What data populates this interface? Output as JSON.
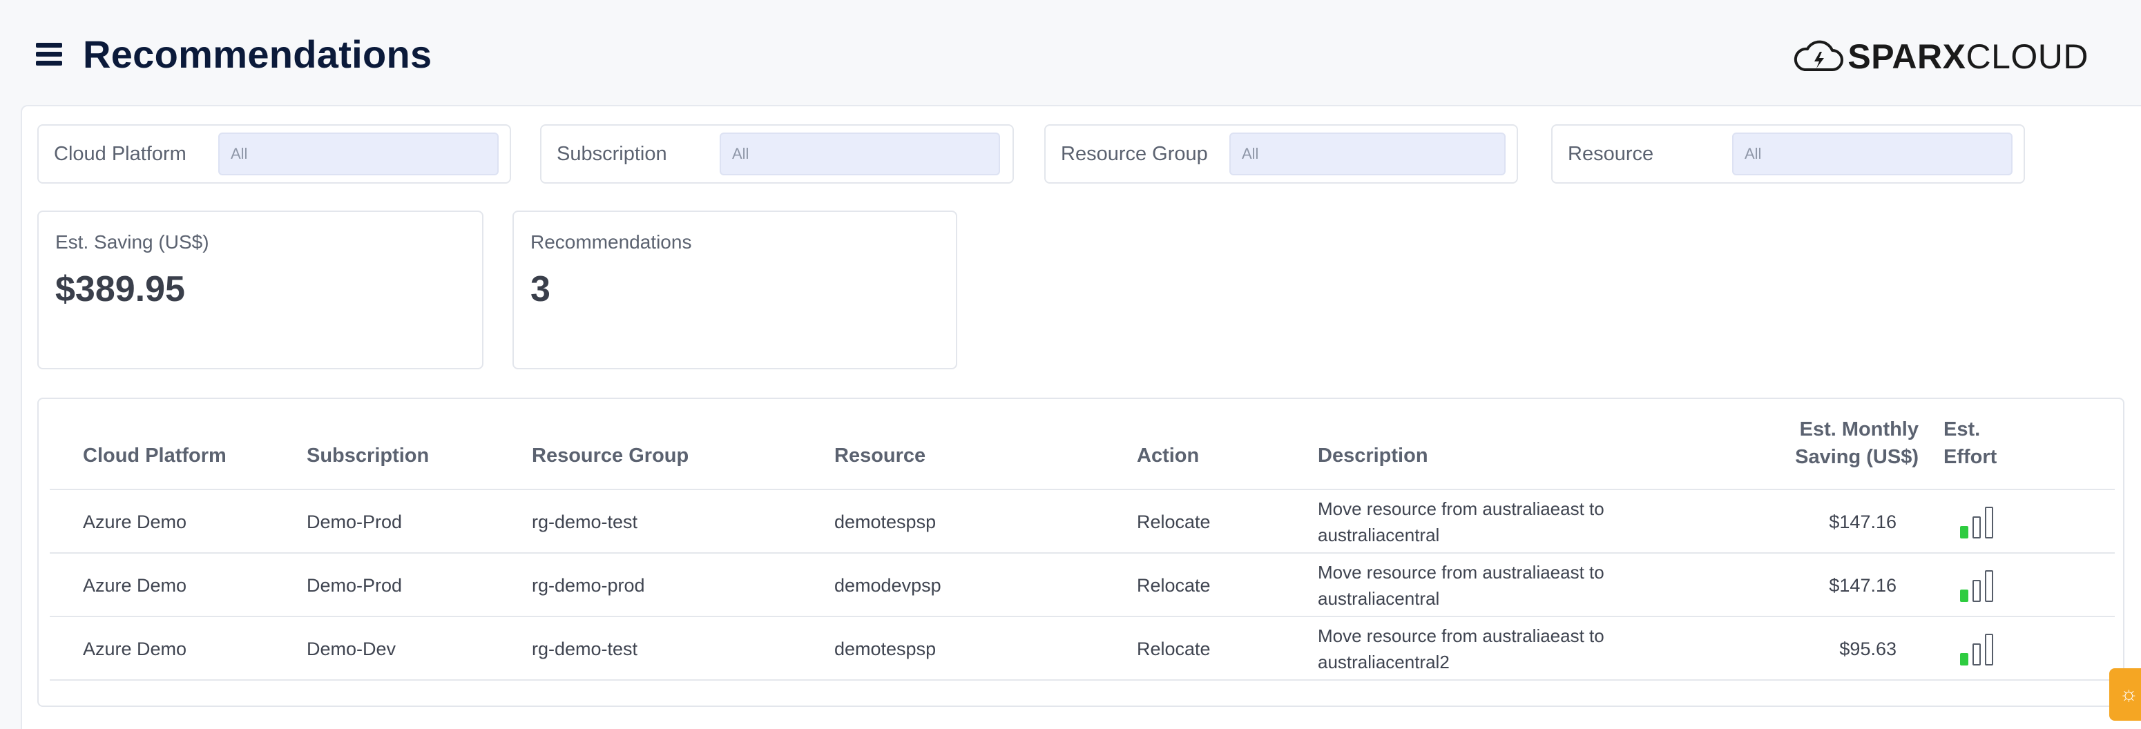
{
  "header": {
    "title": "Recommendations",
    "logo_bold": "SPARX",
    "logo_regular": "CLOUD"
  },
  "filters": [
    {
      "label": "Cloud Platform",
      "value": "All"
    },
    {
      "label": "Subscription",
      "value": "All"
    },
    {
      "label": "Resource Group",
      "value": "All"
    },
    {
      "label": "Resource",
      "value": "All"
    }
  ],
  "summary": {
    "saving_label": "Est. Saving (US$)",
    "saving_value": "$389.95",
    "recs_label": "Recommendations",
    "recs_value": "3"
  },
  "table": {
    "columns": {
      "platform": "Cloud Platform",
      "subscription": "Subscription",
      "resource_group": "Resource Group",
      "resource": "Resource",
      "action": "Action",
      "description": "Description",
      "saving_line1": "Est. Monthly",
      "saving_line2": "Saving (US$)",
      "effort_line1": "Est.",
      "effort_line2": "Effort"
    },
    "rows": [
      {
        "platform": "Azure Demo",
        "subscription": "Demo-Prod",
        "resource_group": "rg-demo-test",
        "resource": "demotespsp",
        "action": "Relocate",
        "desc_line1": "Move resource from australiaeast to",
        "desc_line2": "australiacentral",
        "saving": "$147.16",
        "effort_level": 1
      },
      {
        "platform": "Azure Demo",
        "subscription": "Demo-Prod",
        "resource_group": "rg-demo-prod",
        "resource": "demodevpsp",
        "action": "Relocate",
        "desc_line1": "Move resource from australiaeast to",
        "desc_line2": "australiacentral",
        "saving": "$147.16",
        "effort_level": 1
      },
      {
        "platform": "Azure Demo",
        "subscription": "Demo-Dev",
        "resource_group": "rg-demo-test",
        "resource": "demotespsp",
        "action": "Relocate",
        "desc_line1": "Move resource from australiaeast to",
        "desc_line2": "australiacentral2",
        "saving": "$95.63",
        "effort_level": 1
      }
    ]
  },
  "icons": {
    "menu": "hamburger-menu-icon",
    "logo": "cloud-lightning-icon",
    "effort": "effort-bars-icon",
    "help": "lightbulb-icon"
  },
  "colors": {
    "title": "#0b1a3a",
    "effort_fill": "#2ecc40",
    "help_button": "#f5a623",
    "input_bg": "#e9edfb"
  }
}
